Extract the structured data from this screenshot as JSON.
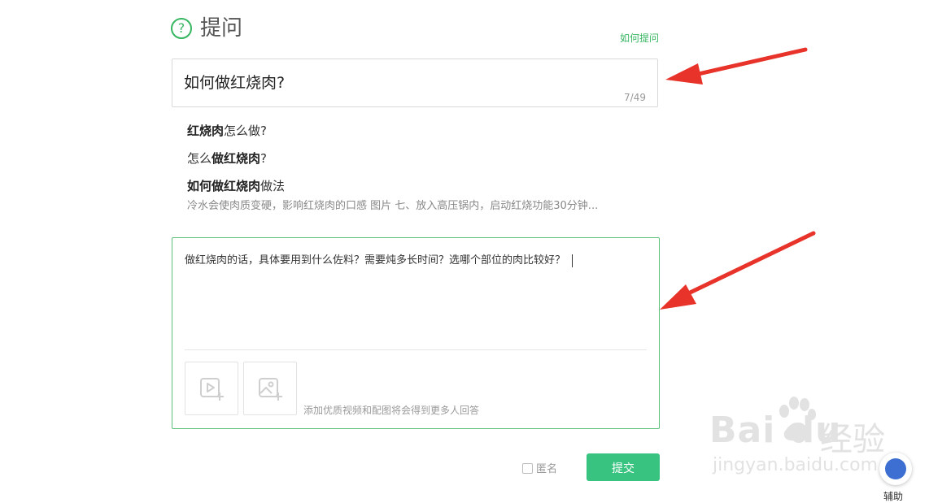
{
  "header": {
    "title": "提问",
    "help_link": "如何提问"
  },
  "question_title": {
    "value": "如何做红烧肉?",
    "counter": "7/49"
  },
  "suggestions": [
    {
      "bold": "红烧肉",
      "rest": "怎么做?"
    },
    {
      "pre": "怎么",
      "bold": "做红烧肉",
      "rest": "?"
    },
    {
      "bold": "如何做红烧肉",
      "rest": "做法"
    }
  ],
  "suggestion_snippet": "冷水会使肉质变硬，影响红烧肉的口感 图片 七、放入高压锅内，启动红烧功能30分钟...",
  "detail": {
    "value": "做红烧肉的话，具体要用到什么佐料？需要炖多长时间？选哪个部位的肉比较好？",
    "media_hint": "添加优质视频和配图将会得到更多人回答"
  },
  "footer": {
    "anonymous_label": "匿名",
    "anonymous_checked": false,
    "submit_label": "提交"
  },
  "watermark": {
    "logo": "Bai  du",
    "cn": "经验",
    "url": "jingyan.baidu.com"
  },
  "assist": {
    "label": "辅助"
  },
  "colors": {
    "accent": "#38c480",
    "arrow": "#e8332a"
  }
}
